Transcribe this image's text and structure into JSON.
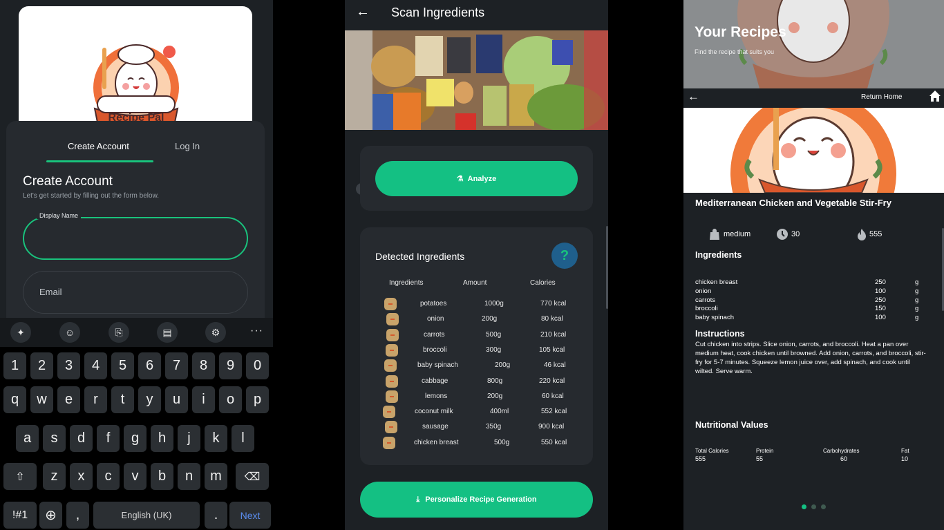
{
  "signup": {
    "tabs": {
      "create": "Create Account",
      "login": "Log In"
    },
    "title": "Create Account",
    "subtitle": "Let's get started by filling out the form below.",
    "display_name_label": "Display Name",
    "email_label": "Email",
    "logo_text": "Recipe Pal"
  },
  "keyboard": {
    "toolbar": [
      "sparkle-icon",
      "emoji-icon",
      "translate-icon",
      "clipboard-icon",
      "gear-icon",
      "more-icon"
    ],
    "more_label": "···",
    "row_numbers": [
      "1",
      "2",
      "3",
      "4",
      "5",
      "6",
      "7",
      "8",
      "9",
      "0"
    ],
    "row_top": [
      "q",
      "w",
      "e",
      "r",
      "t",
      "y",
      "u",
      "i",
      "o",
      "p"
    ],
    "row_mid": [
      "a",
      "s",
      "d",
      "f",
      "g",
      "h",
      "j",
      "k",
      "l"
    ],
    "row_bottom": [
      "z",
      "x",
      "c",
      "v",
      "b",
      "n",
      "m"
    ],
    "symbols_label": "!#1",
    "comma_label": ",",
    "space_label": "English (UK)",
    "period_label": ".",
    "next_label": "Next"
  },
  "scan": {
    "title": "Scan Ingredients",
    "analyze_label": "Analyze",
    "detected_title": "Detected Ingredients",
    "help_label": "?",
    "headers": {
      "ingredient": "Ingredients",
      "amount": "Amount",
      "calories": "Calories"
    },
    "items": [
      {
        "name": "potatoes",
        "amount": "1000g",
        "calories": "770 kcal"
      },
      {
        "name": "onion",
        "amount": "200g",
        "calories": "80 kcal"
      },
      {
        "name": "carrots",
        "amount": "500g",
        "calories": "210 kcal"
      },
      {
        "name": "broccoli",
        "amount": "300g",
        "calories": "105 kcal"
      },
      {
        "name": "baby spinach",
        "amount": "200g",
        "calories": "46 kcal"
      },
      {
        "name": "cabbage",
        "amount": "800g",
        "calories": "220 kcal"
      },
      {
        "name": "lemons",
        "amount": "200g",
        "calories": "60 kcal"
      },
      {
        "name": "coconut milk",
        "amount": "400ml",
        "calories": "552 kcal"
      },
      {
        "name": "sausage",
        "amount": "350g",
        "calories": "900 kcal"
      },
      {
        "name": "chicken breast",
        "amount": "500g",
        "calories": "550 kcal"
      }
    ],
    "generate_label": "Personalize Recipe Generation"
  },
  "recipes": {
    "hero_title": "Your Recipes",
    "hero_subtitle": "Find the recipe that suits you",
    "return_home": "Return Home",
    "recipe_title": "Mediterranean Chicken and Vegetable Stir-Fry",
    "difficulty": "medium",
    "time": "30",
    "calories": "555",
    "ingredients_heading": "Ingredients",
    "ingredients": [
      {
        "name": "chicken breast",
        "qty": "250",
        "unit": "g"
      },
      {
        "name": "onion",
        "qty": "100",
        "unit": "g"
      },
      {
        "name": "carrots",
        "qty": "250",
        "unit": "g"
      },
      {
        "name": "broccoli",
        "qty": "150",
        "unit": "g"
      },
      {
        "name": "baby spinach",
        "qty": "100",
        "unit": "g"
      }
    ],
    "instructions_heading": "Instructions",
    "instructions": "Cut chicken into strips. Slice onion, carrots, and broccoli. Heat a pan over medium heat, cook chicken until browned. Add onion, carrots, and broccoli, stir-fry for 5-7 minutes. Squeeze lemon juice over, add spinach, and cook until wilted. Serve warm.",
    "nutrition_heading": "Nutritional Values",
    "nutrition": [
      {
        "label": "Total Calories",
        "value": "555"
      },
      {
        "label": "Protein",
        "value": "55"
      },
      {
        "label": "Carbohydrates",
        "value": "60"
      },
      {
        "label": "Fat",
        "value": "10"
      }
    ],
    "pager": {
      "count": 3,
      "active": 0
    }
  },
  "colors": {
    "accent": "#14c083",
    "bg": "#1d2125",
    "card": "#262a2f",
    "help": "#1f5f8c"
  }
}
